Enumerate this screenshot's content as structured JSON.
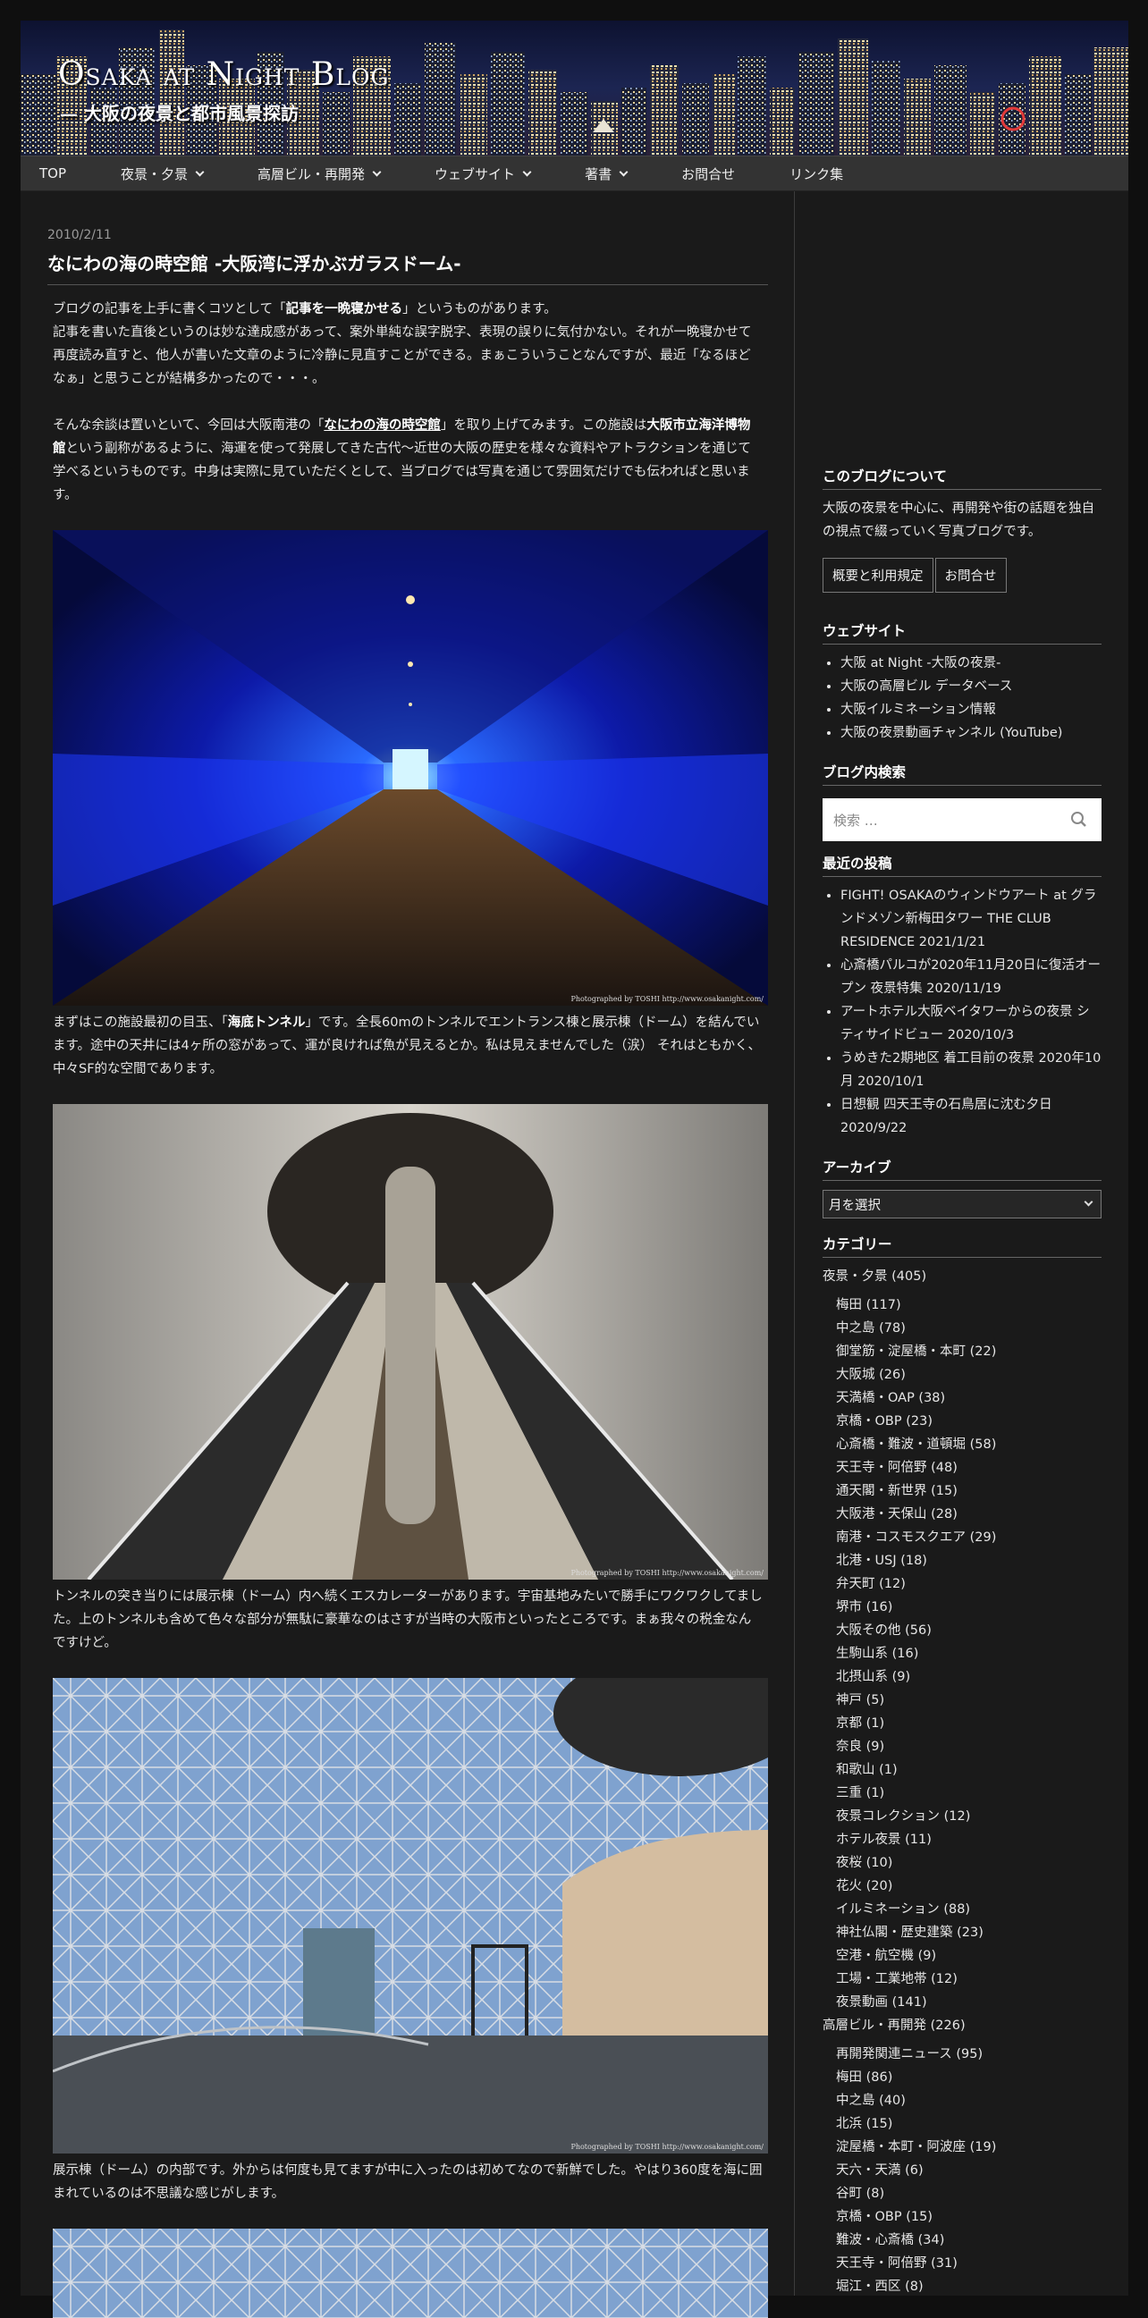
{
  "header": {
    "logo": "Osaka at Night Blog",
    "tagline": "— 大阪の夜景と都市風景探訪"
  },
  "nav": [
    {
      "label": "TOP",
      "dropdown": false
    },
    {
      "label": "夜景・夕景",
      "dropdown": true
    },
    {
      "label": "高層ビル・再開発",
      "dropdown": true
    },
    {
      "label": "ウェブサイト",
      "dropdown": true
    },
    {
      "label": "著書",
      "dropdown": true
    },
    {
      "label": "お問合せ",
      "dropdown": false
    },
    {
      "label": "リンク集",
      "dropdown": false
    }
  ],
  "post": {
    "date": "2010/2/11",
    "title": "なにわの海の時空館 -大阪湾に浮かぶガラスドーム-",
    "intro": {
      "p1_a": "ブログの記事を上手に書くコツとして「",
      "p1_b": "記事を一晩寝かせる",
      "p1_c": "」というものがあります。",
      "p1_d": "記事を書いた直後というのは妙な達成感があって、案外単純な誤字脱字、表現の誤りに気付かない。それが一晩寝かせて再度読み直すと、他人が書いた文章のように冷静に見直すことができる。まぁこういうことなんですが、最近「なるほどなぁ」と思うことが結構多かったので・・・。",
      "p2_a": "そんな余談は置いといて、今回は大阪南港の「",
      "p2_b": "なにわの海の時空館",
      "p2_c": "」を取り上げてみます。この施設は",
      "p2_d": "大阪市立海洋博物館",
      "p2_e": "という副称があるように、海運を使って発展してきた古代～近世の大阪の歴史を様々な資料やアトラクションを通じて学べるというものです。中身は実際に見ていただくとして、当ブログでは写真を通じて雰囲気だけでも伝わればと思います。"
    },
    "credit": "Photographed by TOSHI  http://www.osakanight.com/",
    "caption1_a": "まずはこの施設最初の目玉、「",
    "caption1_b": "海底トンネル",
    "caption1_c": "」です。全長60mのトンネルでエントランス棟と展示棟（ドーム）を結んでいます。途中の天井には4ヶ所の窓があって、運が良ければ魚が見えるとか。私は見えませんでした（涙） それはともかく、中々SF的な空間であります。",
    "caption2": "トンネルの突き当りには展示棟（ドーム）内へ続くエスカレーターがあります。宇宙基地みたいで勝手にワクワクしてました。上のトンネルも含めて色々な部分が無駄に豪華なのはさすが当時の大阪市といったところです。まぁ我々の税金なんですけど。",
    "caption3": "展示棟（ドーム）の内部です。外からは何度も見てますが中に入ったのは初めてなので新鮮でした。やはり360度を海に囲まれているのは不思議な感じがします。"
  },
  "sidebar": {
    "about_title": "このブログについて",
    "about_text": "大阪の夜景を中心に、再開発や街の話題を独自の視点で綴っていく写真ブログです。",
    "about_btn1": "概要と利用規定",
    "about_btn2": "お問合せ",
    "websites_title": "ウェブサイト",
    "websites": [
      "大阪 at Night -大阪の夜景-",
      "大阪の高層ビル データベース",
      "大阪イルミネーション情報",
      "大阪の夜景動画チャンネル (YouTube)"
    ],
    "search_title": "ブログ内検索",
    "search_placeholder": "検索 …",
    "recent_title": "最近の投稿",
    "recent": [
      "FIGHT! OSAKAのウィンドウアート at グランドメゾン新梅田タワー THE CLUB RESIDENCE 2021/1/21",
      "心斎橋パルコが2020年11月20日に復活オープン 夜景特集 2020/11/19",
      "アートホテル大阪ベイタワーからの夜景 シティサイドビュー 2020/10/3",
      "うめきた2期地区 着工目前の夜景 2020年10月 2020/10/1",
      "日想観 四天王寺の石鳥居に沈む夕日 2020/9/22"
    ],
    "archive_title": "アーカイブ",
    "archive_select": "月を選択",
    "category_title": "カテゴリー",
    "cat1": "夜景・夕景 (405)",
    "cat1_items": [
      "梅田 (117)",
      "中之島 (78)",
      "御堂筋・淀屋橋・本町 (22)",
      "大阪城 (26)",
      "天満橋・OAP (38)",
      "京橋・OBP (23)",
      "心斎橋・難波・道頓堀 (58)",
      "天王寺・阿倍野 (48)",
      "通天閣・新世界 (15)",
      "大阪港・天保山 (28)",
      "南港・コスモスクエア (29)",
      "北港・USJ (18)",
      "弁天町 (12)",
      "堺市 (16)",
      "大阪その他 (56)",
      "生駒山系 (16)",
      "北摂山系 (9)",
      "神戸 (5)",
      "京都 (1)",
      "奈良 (9)",
      "和歌山 (1)",
      "三重 (1)",
      "夜景コレクション (12)",
      "ホテル夜景 (11)",
      "夜桜 (10)",
      "花火 (20)",
      "イルミネーション (88)",
      "神社仏閣・歴史建築 (23)",
      "空港・航空機 (9)",
      "工場・工業地帯 (12)",
      "夜景動画 (141)"
    ],
    "cat2": "高層ビル・再開発 (226)",
    "cat2_items": [
      "再開発関連ニュース (95)",
      "梅田 (86)",
      "中之島 (40)",
      "北浜 (15)",
      "淀屋橋・本町・阿波座 (19)",
      "天六・天満 (6)",
      "谷町 (8)",
      "京橋・OBP (15)",
      "難波・心斎橋 (34)",
      "天王寺・阿倍野 (31)",
      "堀江・西区 (8)"
    ]
  }
}
